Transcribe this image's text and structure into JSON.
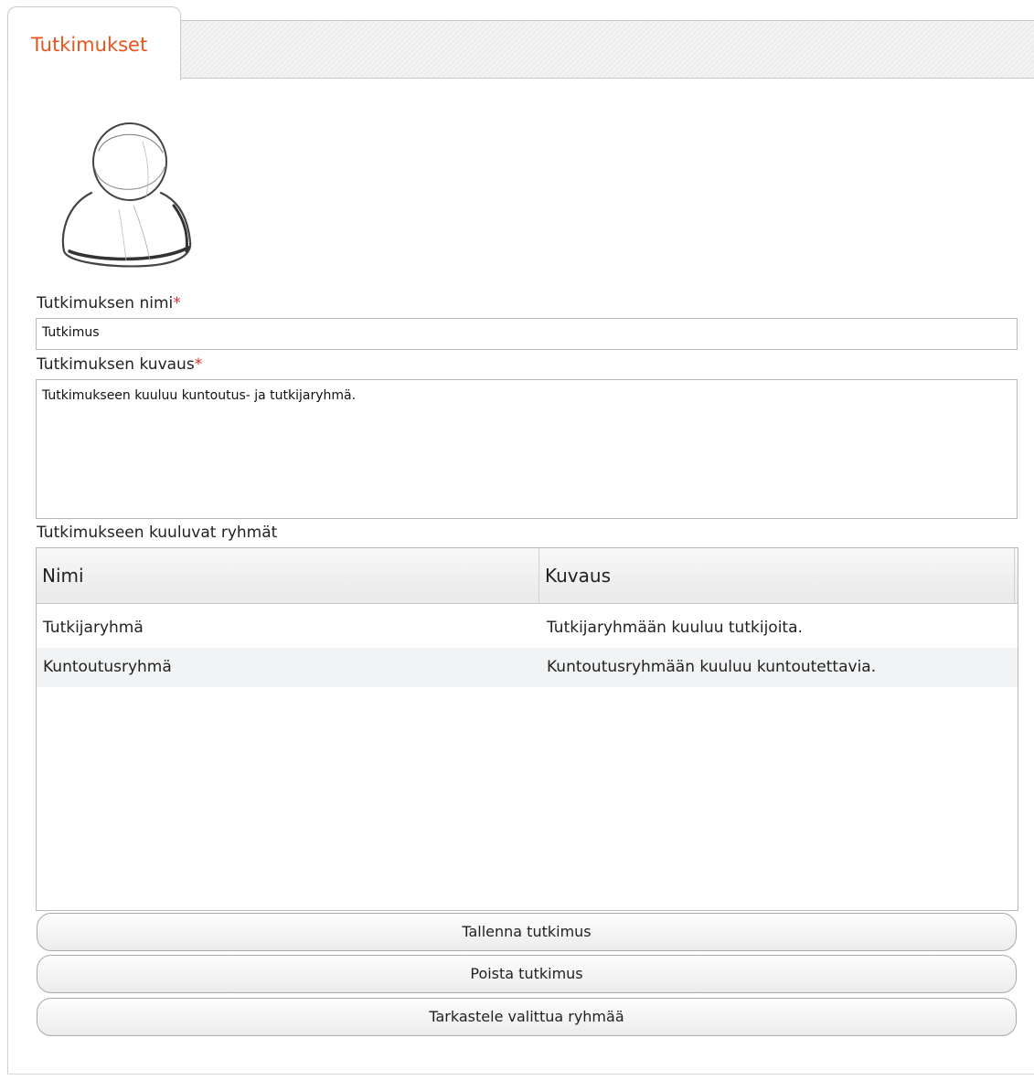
{
  "tabs": [
    {
      "label": "Tutkimukset",
      "active": true
    }
  ],
  "accent_color": "#e8541b",
  "required_color": "#e22b2b",
  "avatar": {
    "icon": "user-avatar-icon"
  },
  "form": {
    "name_label": "Tutkimuksen nimi",
    "name_value": "Tutkimus",
    "description_label": "Tutkimuksen kuvaus",
    "description_value": "Tutkimukseen kuuluu kuntoutus- ja tutkijaryhmä.",
    "required_marker": "*"
  },
  "groups": {
    "title": "Tutkimukseen kuuluvat ryhmät",
    "columns": [
      "Nimi",
      "Kuvaus"
    ],
    "rows": [
      {
        "name": "Tutkijaryhmä",
        "description": "Tutkijaryhmään kuuluu tutkijoita."
      },
      {
        "name": "Kuntoutusryhmä",
        "description": "Kuntoutusryhmään kuuluu kuntoutettavia."
      }
    ]
  },
  "buttons": {
    "save": "Tallenna tutkimus",
    "delete": "Poista tutkimus",
    "view_group": "Tarkastele valittua ryhmää"
  }
}
